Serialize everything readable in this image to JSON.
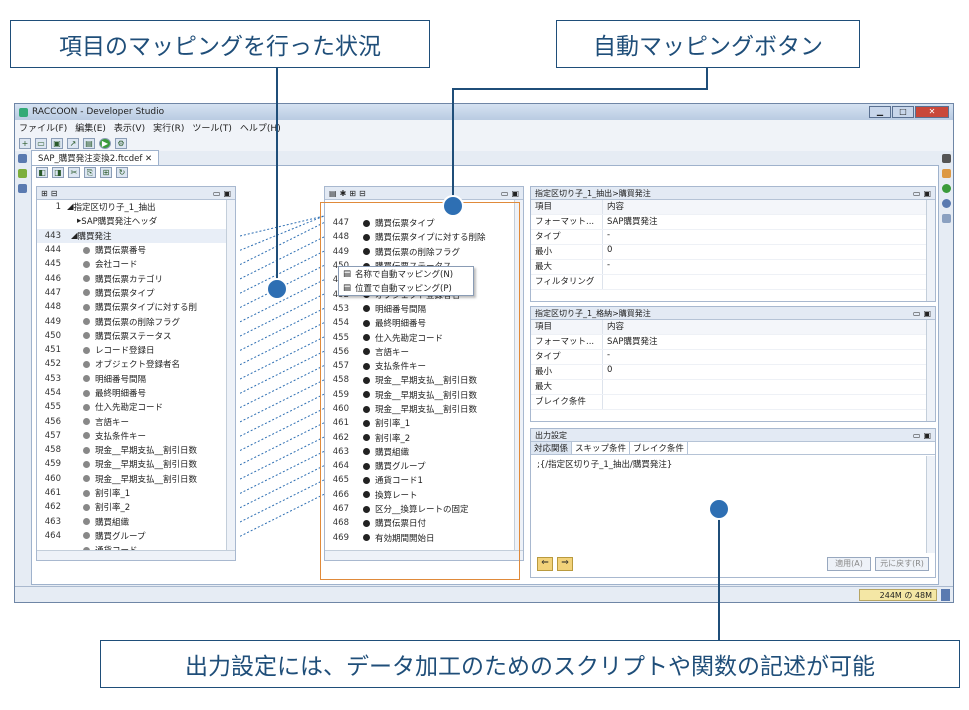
{
  "callouts": {
    "mapping": "項目のマッピングを行った状況",
    "auto_button": "自動マッピングボタン",
    "output": "出力設定には、データ加工のためのスクリプトや関数の記述が可能"
  },
  "window": {
    "title": "RACCOON - Developer Studio",
    "menu": [
      "ファイル(F)",
      "編集(E)",
      "表示(V)",
      "実行(R)",
      "ツール(T)",
      "ヘルプ(H)"
    ],
    "tab": "SAP_購買発注変換2.ftcdef"
  },
  "left_tree": {
    "root": [
      "指定区切り子_1_抽出",
      "SAP購買発注ヘッダ"
    ],
    "root_nums": [
      "1",
      ""
    ],
    "group_num": "443",
    "group": "購買発注",
    "rows": [
      {
        "n": "444",
        "t": "購買伝票番号"
      },
      {
        "n": "445",
        "t": "会社コード"
      },
      {
        "n": "446",
        "t": "購買伝票カテゴリ"
      },
      {
        "n": "447",
        "t": "購買伝票タイプ"
      },
      {
        "n": "448",
        "t": "購買伝票タイプに対する削"
      },
      {
        "n": "449",
        "t": "購買伝票の削除フラグ"
      },
      {
        "n": "450",
        "t": "購買伝票ステータス"
      },
      {
        "n": "451",
        "t": "レコード登録日"
      },
      {
        "n": "452",
        "t": "オブジェクト登録者名"
      },
      {
        "n": "453",
        "t": "明細番号間隔"
      },
      {
        "n": "454",
        "t": "最終明細番号"
      },
      {
        "n": "455",
        "t": "仕入先勘定コード"
      },
      {
        "n": "456",
        "t": "言語キー"
      },
      {
        "n": "457",
        "t": "支払条件キー"
      },
      {
        "n": "458",
        "t": "現金__早期支払__割引日数"
      },
      {
        "n": "459",
        "t": "現金__早期支払__割引日数"
      },
      {
        "n": "460",
        "t": "現金__早期支払__割引日数"
      },
      {
        "n": "461",
        "t": "割引率_1"
      },
      {
        "n": "462",
        "t": "割引率_2"
      },
      {
        "n": "463",
        "t": "購買組織"
      },
      {
        "n": "464",
        "t": "購買グループ"
      },
      {
        "n": "",
        "t": "通貨コード"
      }
    ]
  },
  "right_tree": {
    "rows": [
      {
        "n": "447",
        "t": "購買伝票タイプ"
      },
      {
        "n": "448",
        "t": "購買伝票タイプに対する削除"
      },
      {
        "n": "449",
        "t": "購買伝票の削除フラグ"
      },
      {
        "n": "450",
        "t": "購買伝票ステータス"
      },
      {
        "n": "451",
        "t": "レコード登録日"
      },
      {
        "n": "452",
        "t": "オブジェクト登録者名"
      },
      {
        "n": "453",
        "t": "明細番号間隔"
      },
      {
        "n": "454",
        "t": "最終明細番号"
      },
      {
        "n": "455",
        "t": "仕入先勘定コード"
      },
      {
        "n": "456",
        "t": "言語キー"
      },
      {
        "n": "457",
        "t": "支払条件キー"
      },
      {
        "n": "458",
        "t": "現金__早期支払__割引日数"
      },
      {
        "n": "459",
        "t": "現金__早期支払__割引日数"
      },
      {
        "n": "460",
        "t": "現金__早期支払__割引日数"
      },
      {
        "n": "461",
        "t": "割引率_1"
      },
      {
        "n": "462",
        "t": "割引率_2"
      },
      {
        "n": "463",
        "t": "購買組織"
      },
      {
        "n": "464",
        "t": "購買グループ"
      },
      {
        "n": "465",
        "t": "通貨コード1"
      },
      {
        "n": "466",
        "t": "換算レート"
      },
      {
        "n": "467",
        "t": "区分__換算レートの固定"
      },
      {
        "n": "468",
        "t": "購買伝票日付"
      },
      {
        "n": "469",
        "t": "有効期間開始日"
      }
    ]
  },
  "popup": {
    "items": [
      "名称で自動マッピング(N)",
      "位置で自動マッピング(P)"
    ]
  },
  "prop1": {
    "title": "指定区切り子_1_抽出>購買発注",
    "head": [
      "項目",
      "内容"
    ],
    "rows": [
      {
        "k": "フォーマット...",
        "v": "SAP購買発注"
      },
      {
        "k": "タイプ",
        "v": "-"
      },
      {
        "k": "最小",
        "v": "0"
      },
      {
        "k": "最大",
        "v": "-"
      },
      {
        "k": "フィルタリング",
        "v": ""
      }
    ]
  },
  "prop2": {
    "title": "指定区切り子_1_格納>購買発注",
    "head": [
      "項目",
      "内容"
    ],
    "rows": [
      {
        "k": "フォーマット...",
        "v": "SAP購買発注"
      },
      {
        "k": "タイプ",
        "v": "-"
      },
      {
        "k": "最小",
        "v": "0"
      },
      {
        "k": "最大",
        "v": ""
      },
      {
        "k": "ブレイク条件",
        "v": ""
      }
    ]
  },
  "output": {
    "title": "出力設定",
    "tabs": [
      "対応関係",
      "スキップ条件",
      "ブレイク条件"
    ],
    "script": ";{/指定区切り子_1_抽出/購買発注}",
    "apply": "適用(A)",
    "restore": "元に戻す(R)"
  },
  "status": {
    "memory": "244M の 48M"
  },
  "colors": {
    "accent": "#1f4e79",
    "dot": "#2e6fb3",
    "highlight": "#e08a3a"
  }
}
